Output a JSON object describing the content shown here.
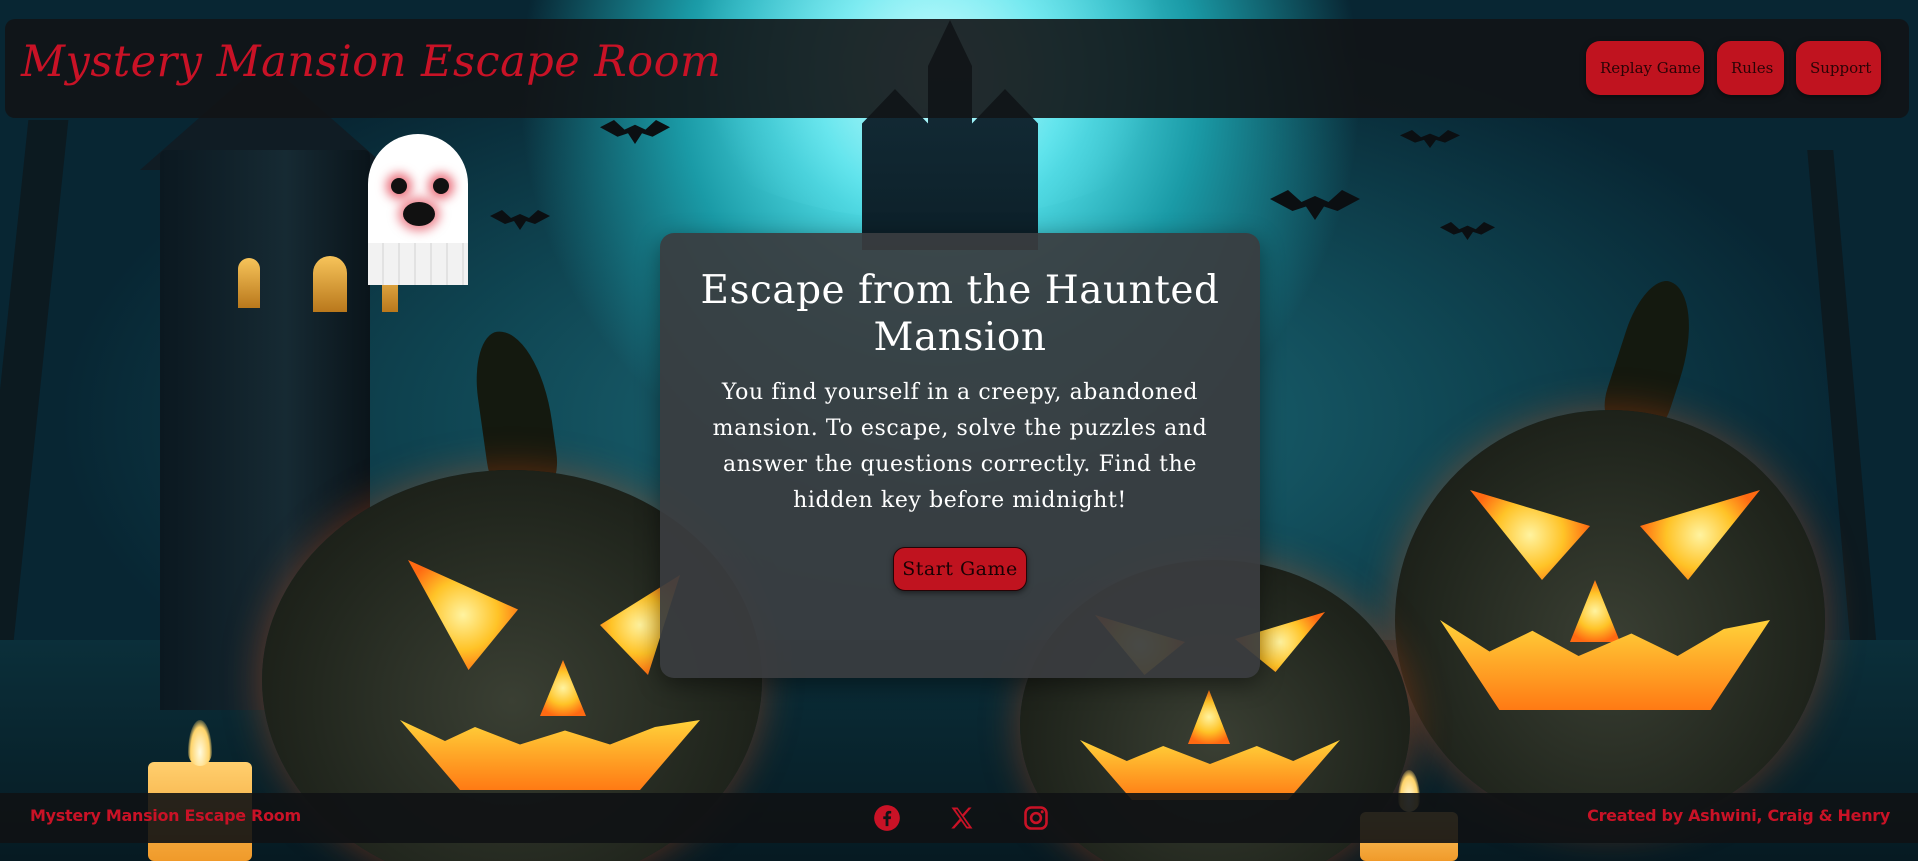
{
  "header": {
    "title": "Mystery Mansion Escape Room",
    "nav": {
      "replay_label": "Replay Game",
      "rules_label": "Rules",
      "support_label": "Support"
    }
  },
  "main": {
    "card_title": "Escape from the Haunted Mansion",
    "card_text": "You find yourself in a creepy, abandoned mansion. To escape, solve the puzzles and answer the questions correctly. Find the hidden key before midnight!",
    "start_label": "Start Game"
  },
  "footer": {
    "title": "Mystery Mansion Escape Room",
    "credit": "Created by Ashwini, Craig & Henry",
    "social_icons": [
      "facebook-icon",
      "x-icon",
      "instagram-icon"
    ]
  },
  "colors": {
    "accent": "#c0131f",
    "title_red": "#c91226",
    "card_bg": "#3a3c3f",
    "header_bg": "#121416"
  }
}
